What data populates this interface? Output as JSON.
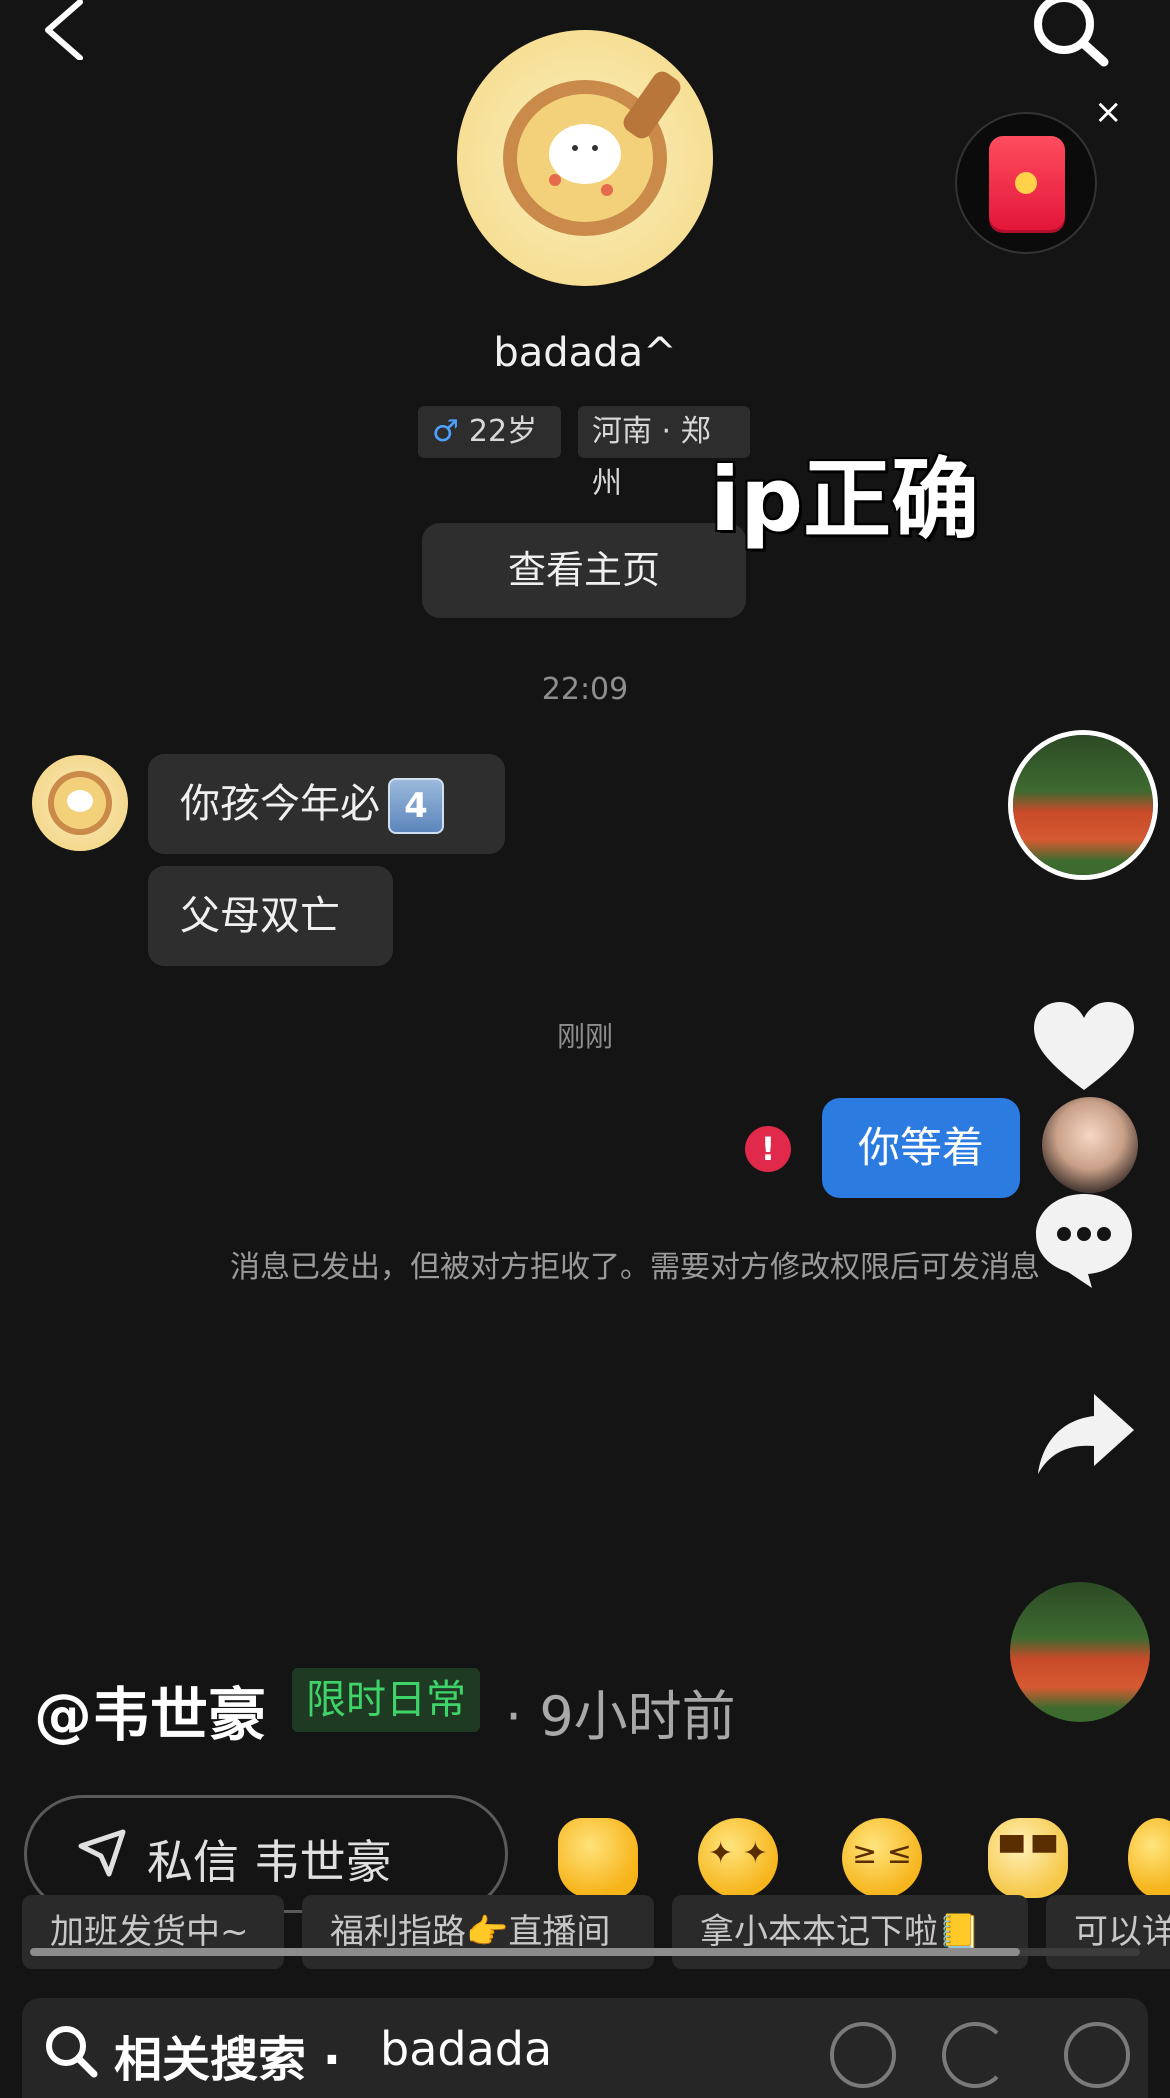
{
  "top_bar": {
    "back_icon": "chevron-left-icon",
    "search_icon": "search-icon"
  },
  "profile": {
    "name": "badada^",
    "gender_symbol": "♂",
    "age": "22岁",
    "location": "河南 · 郑州",
    "view_home_label": "查看主页"
  },
  "overlay_caption": "ip正确",
  "chat": {
    "timestamp_1": "22:09",
    "messages_in": [
      {
        "text": "你孩今年必",
        "emoji": "4"
      },
      {
        "text": "父母双亡"
      }
    ],
    "timestamp_2": "刚刚",
    "message_out": "你等着",
    "error_mark": "!",
    "reject_note": "消息已发出，但被对方拒收了。需要对方修改权限后可发消息"
  },
  "right_rail": {
    "close_symbol": "×",
    "icons": [
      "red-envelope-icon",
      "heart-icon",
      "comment-icon",
      "share-icon"
    ]
  },
  "video_meta": {
    "author": "@韦世豪",
    "tag": "限时日常",
    "time_ago": "· 9小时前"
  },
  "dm": {
    "label": "私信 韦世豪"
  },
  "emojis": [
    "thumbs-up",
    "star-eyes",
    "laughing-tears",
    "cool-dog",
    "partial-emoji"
  ],
  "suggest_chips": [
    "加班发货中~",
    "福利指路👉直播间",
    "拿小本本记下啦📒",
    "可以详"
  ],
  "related": {
    "label": "相关搜索",
    "separator": "·",
    "term": "badada"
  },
  "colors": {
    "accent_blue": "#2b7be0",
    "error_red": "#e0294b",
    "tag_green": "#3fd46a",
    "background": "#141414"
  }
}
